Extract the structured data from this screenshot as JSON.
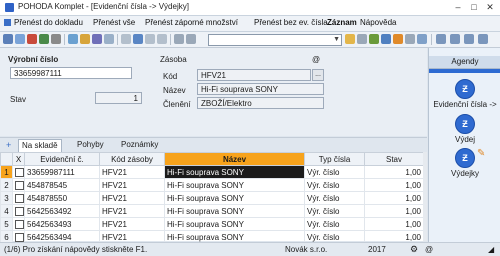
{
  "window": {
    "title": "POHODA Komplet - [Evidenční čísla -> Výdejky]"
  },
  "menu": {
    "items": [
      {
        "label": "Přenést do dokladu",
        "bold": false
      },
      {
        "label": "Přenést vše",
        "bold": false
      },
      {
        "label": "Přenést záporné množství",
        "bold": false
      },
      {
        "label": "Přenést bez ev. čísla",
        "bold": false
      },
      {
        "label": "Záznam",
        "bold": true
      },
      {
        "label": "Nápověda",
        "bold": false
      }
    ]
  },
  "form": {
    "serial_label": "Výrobní číslo",
    "serial_value": "33659987111",
    "state_label": "Stav",
    "state_value": "1",
    "stock_label": "Zásoba",
    "code_label": "Kód",
    "code_value": "HFV21",
    "name_label": "Název",
    "name_value": "Hi-Fi souprava SONY",
    "class_label": "Členění",
    "class_value": "ZBOŽÍ/Elektro",
    "dots": "..."
  },
  "tabs": {
    "items": [
      "Na skladě",
      "Pohyby",
      "Poznámky"
    ]
  },
  "grid": {
    "columns": [
      "",
      "X",
      "Evidenční č.",
      "Kód zásoby",
      "Název",
      "Typ čísla",
      "Stav"
    ],
    "rows": [
      {
        "rn": "1",
        "serial": "33659987111",
        "code": "HFV21",
        "name": "Hi-Fi souprava SONY",
        "type": "Výr. číslo",
        "state": "1,00"
      },
      {
        "rn": "2",
        "serial": "454878545",
        "code": "HFV21",
        "name": "Hi-Fi souprava SONY",
        "type": "Výr. číslo",
        "state": "1,00"
      },
      {
        "rn": "3",
        "serial": "454878550",
        "code": "HFV21",
        "name": "Hi-Fi souprava SONY",
        "type": "Výr. číslo",
        "state": "1,00"
      },
      {
        "rn": "4",
        "serial": "5642563492",
        "code": "HFV21",
        "name": "Hi-Fi souprava SONY",
        "type": "Výr. číslo",
        "state": "1,00"
      },
      {
        "rn": "5",
        "serial": "5642563493",
        "code": "HFV21",
        "name": "Hi-Fi souprava SONY",
        "type": "Výr. číslo",
        "state": "1,00"
      },
      {
        "rn": "6",
        "serial": "5642563494",
        "code": "HFV21",
        "name": "Hi-Fi souprava SONY",
        "type": "Výr. číslo",
        "state": "1,00"
      }
    ]
  },
  "status": {
    "hint": "(1/6) Pro získání nápovědy stiskněte F1.",
    "company": "Novák s.r.o.",
    "year": "2017"
  },
  "agenda": {
    "title": "Agendy",
    "items": [
      {
        "label": "Evidenční čísla ->"
      },
      {
        "label": "Výdej"
      },
      {
        "label": "Výdejky"
      }
    ]
  },
  "colors": {
    "accent": "#f7a31c",
    "highlight_row": "#1b1b1b",
    "agenda_blue": "#2e6bd2"
  }
}
